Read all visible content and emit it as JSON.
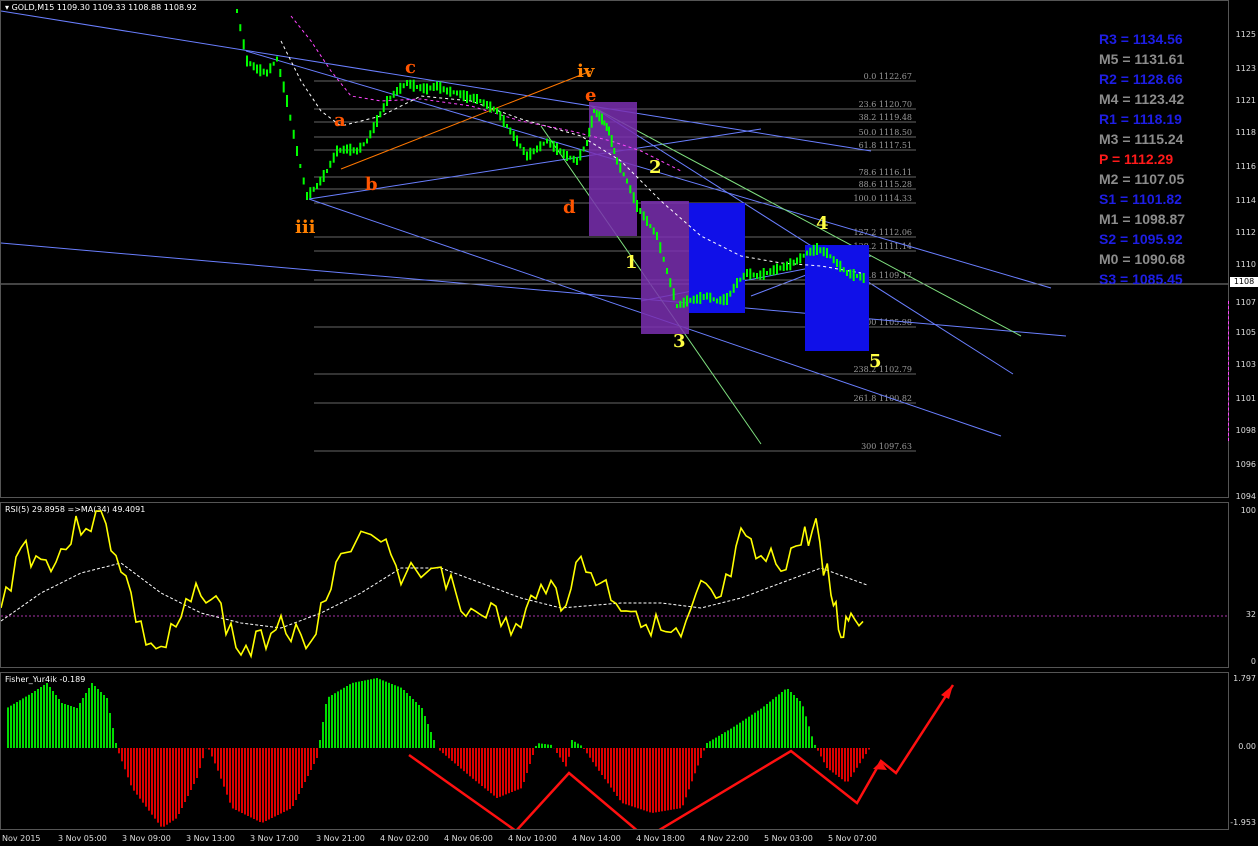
{
  "main": {
    "header": "GOLD,M15  1109.30 1109.33 1108.88 1108.92",
    "price_scale": [
      "1125",
      "1123",
      "1121",
      "1118",
      "1116",
      "1114",
      "1112",
      "1110",
      "1108",
      "1107",
      "1105",
      "1103",
      "1101",
      "1098",
      "1096",
      "1094"
    ],
    "current_price": "1108",
    "pivots": [
      {
        "label": "R3 = 1134.56",
        "color": "#1e1ee6"
      },
      {
        "label": "M5 = 1131.61",
        "color": "#8c8c8c"
      },
      {
        "label": "R2 = 1128.66",
        "color": "#1e1ee6"
      },
      {
        "label": "M4 = 1123.42",
        "color": "#8c8c8c"
      },
      {
        "label": "R1 = 1118.19",
        "color": "#1e1ee6"
      },
      {
        "label": "M3 = 1115.24",
        "color": "#8c8c8c"
      },
      {
        "label": "P  = 1112.29",
        "color": "#ff1a1a"
      },
      {
        "label": "M2 = 1107.05",
        "color": "#8c8c8c"
      },
      {
        "label": "S1 = 1101.82",
        "color": "#1e1ee6"
      },
      {
        "label": "M1 = 1098.87",
        "color": "#8c8c8c"
      },
      {
        "label": "S2 = 1095.92",
        "color": "#1e1ee6"
      },
      {
        "label": "M0 = 1090.68",
        "color": "#8c8c8c"
      },
      {
        "label": "S3 = 1085.45",
        "color": "#1e1ee6"
      }
    ],
    "fib_levels": [
      "0.0  1122.67",
      "23.6  1120.70",
      "38.2  1119.48",
      "50.0  1118.50",
      "61.8  1117.51",
      "78.6  1116.11",
      "88.6  1115.28",
      "100.0  1114.33",
      "127.2  1112.06",
      "138.2  1111.14",
      "161.8  1109.17",
      "200  1105.98",
      "238.2  1102.79",
      "261.8  1100.82",
      "300  1097.63"
    ],
    "wave_labels": {
      "iii": "iii",
      "a": "a",
      "b": "b",
      "c": "c",
      "iv": "iv",
      "d": "d",
      "e": "e",
      "w1": "1",
      "w2": "2",
      "w3": "3",
      "w4": "4",
      "w5": "5"
    }
  },
  "rsi": {
    "header": "RSI(5) 29.8958  =>MA(34) 49.4091",
    "scale": [
      "100",
      "32",
      "0"
    ]
  },
  "fisher": {
    "header": "Fisher_Yur4ik -0.189",
    "scale": [
      "1.797",
      "0.00",
      "-1.953"
    ]
  },
  "time_axis": [
    "Nov 2015",
    "3 Nov 05:00",
    "3 Nov 09:00",
    "3 Nov 13:00",
    "3 Nov 17:00",
    "3 Nov 21:00",
    "4 Nov 02:00",
    "4 Nov 06:00",
    "4 Nov 10:00",
    "4 Nov 14:00",
    "4 Nov 18:00",
    "4 Nov 22:00",
    "5 Nov 03:00",
    "5 Nov 07:00"
  ],
  "colors": {
    "candle": "#00ff00",
    "rsi": "#ffff00",
    "fisher_up": "#00dd00",
    "fisher_down": "#dd0000",
    "arrow": "#ff0000",
    "trend": "#6a7fff"
  }
}
